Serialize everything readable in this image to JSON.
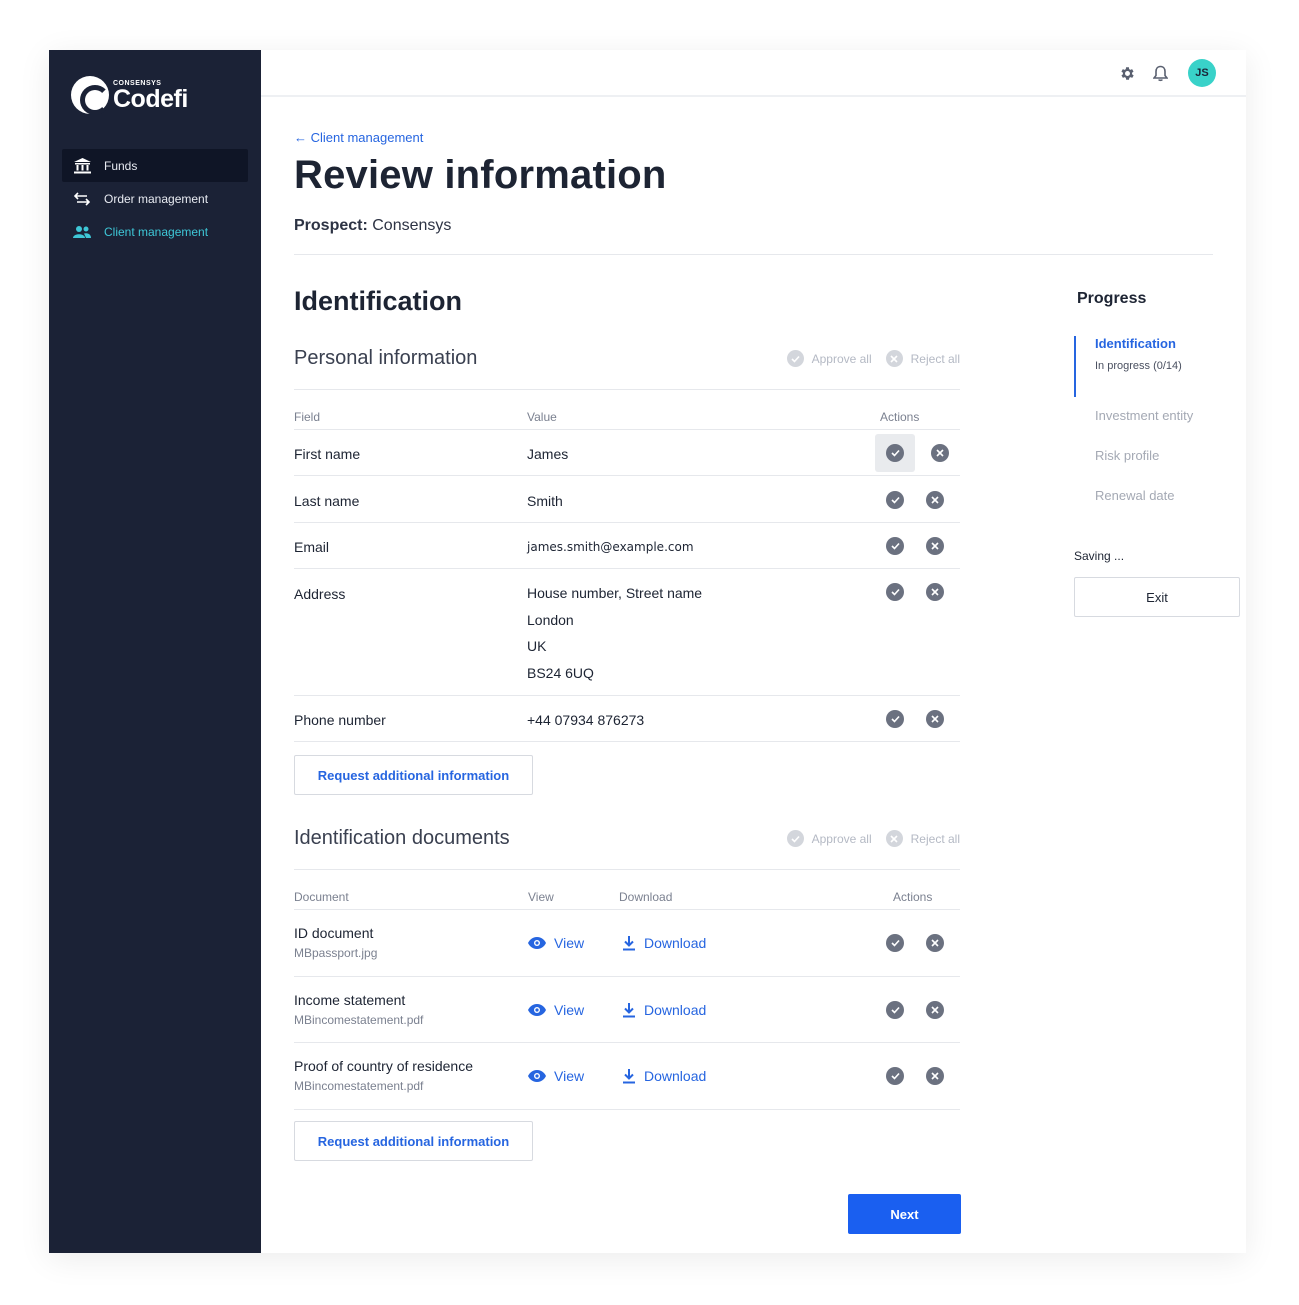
{
  "brand": {
    "small": "CONSENSYS",
    "name": "Codefi"
  },
  "sidebar": {
    "items": [
      {
        "label": "Funds",
        "icon": "bank-icon"
      },
      {
        "label": "Order management",
        "icon": "transfer-arrows-icon"
      },
      {
        "label": "Client management",
        "icon": "users-icon"
      }
    ]
  },
  "topbar": {
    "avatar_initials": "JS"
  },
  "header": {
    "back_label": "Client management",
    "title": "Review information",
    "prospect_label": "Prospect:",
    "prospect_value": "Consensys"
  },
  "section_title": "Identification",
  "personal": {
    "title": "Personal information",
    "approve_all": "Approve all",
    "reject_all": "Reject all",
    "columns": [
      "Field",
      "Value",
      "Actions"
    ],
    "rows": [
      {
        "field": "First name",
        "value": "James"
      },
      {
        "field": "Last name",
        "value": "Smith"
      },
      {
        "field": "Email",
        "value": "james.smith@example.com"
      },
      {
        "field": "Address",
        "lines": [
          "House number, Street name",
          "London",
          "UK",
          "BS24 6UQ"
        ]
      },
      {
        "field": "Phone number",
        "value": "+44 07934 876273"
      }
    ],
    "request_label": "Request additional information"
  },
  "documents": {
    "title": "Identification documents",
    "approve_all": "Approve all",
    "reject_all": "Reject all",
    "columns": [
      "Document",
      "View",
      "Download",
      "Actions"
    ],
    "rows": [
      {
        "name": "ID document",
        "file": "MBpassport.jpg",
        "view": "View",
        "download": "Download"
      },
      {
        "name": "Income statement",
        "file": "MBincomestatement.pdf",
        "view": "View",
        "download": "Download"
      },
      {
        "name": "Proof of country of residence",
        "file": "MBincomestatement.pdf",
        "view": "View",
        "download": "Download"
      }
    ],
    "request_label": "Request additional information"
  },
  "next_label": "Next",
  "progress": {
    "title": "Progress",
    "steps": [
      {
        "label": "Identification",
        "sub": "In progress (0/14)"
      },
      {
        "label": "Investment entity"
      },
      {
        "label": "Risk profile"
      },
      {
        "label": "Renewal date"
      }
    ],
    "saving": "Saving ...",
    "exit_label": "Exit"
  },
  "colors": {
    "sidebar": "#1b2236",
    "accent": "#2665e0",
    "primary_button": "#1a5ff0",
    "avatar": "#39d2c9",
    "active_nav": "#3ec7d7"
  }
}
